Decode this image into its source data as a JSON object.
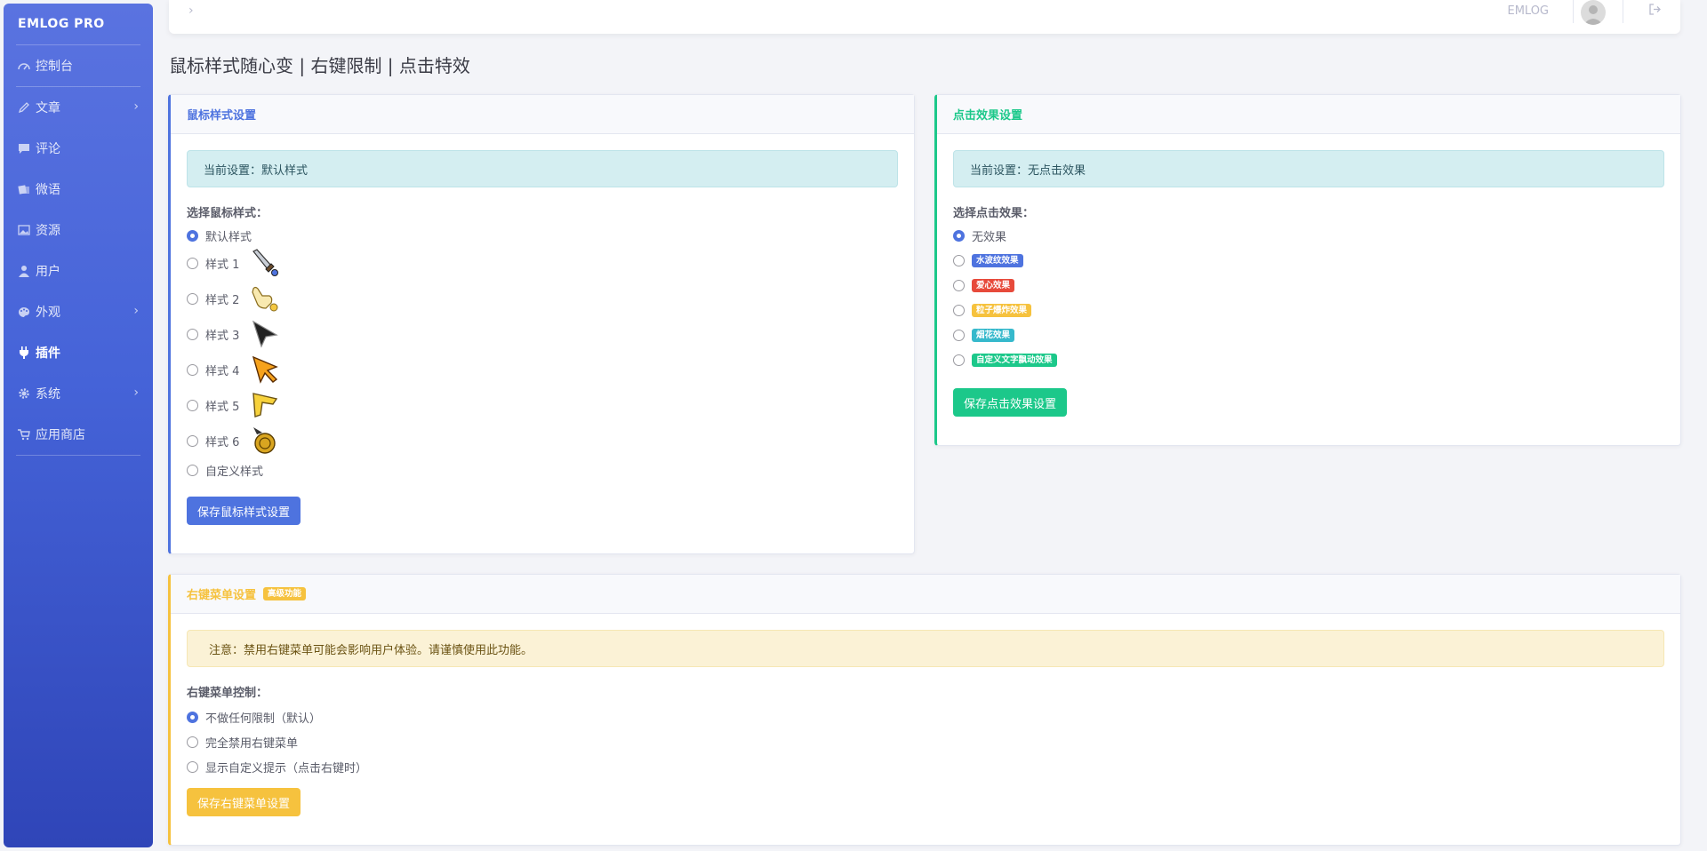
{
  "sidebar": {
    "brand": "EMLOG PRO",
    "items": [
      {
        "label": "控制台",
        "icon": "dashboard-icon"
      },
      {
        "label": "文章",
        "icon": "pencil-icon",
        "has_children": true
      },
      {
        "label": "评论",
        "icon": "comment-icon"
      },
      {
        "label": "微语",
        "icon": "note-icon"
      },
      {
        "label": "资源",
        "icon": "image-icon"
      },
      {
        "label": "用户",
        "icon": "user-icon"
      },
      {
        "label": "外观",
        "icon": "palette-icon",
        "has_children": true
      },
      {
        "label": "插件",
        "icon": "plug-icon",
        "active": true
      },
      {
        "label": "系统",
        "icon": "gear-icon",
        "has_children": true
      },
      {
        "label": "应用商店",
        "icon": "cart-icon"
      }
    ]
  },
  "topbar": {
    "toggle": "›",
    "site_name": "EMLOG",
    "logout_icon": "logout-icon"
  },
  "page_title": "鼠标样式随心变 | 右键限制 | 点击特效",
  "mouse_card": {
    "title": "鼠标样式设置",
    "accent": "#4e73df",
    "current": "当前设置：默认样式",
    "select_label": "选择鼠标样式：",
    "options": [
      {
        "label": "默认样式",
        "checked": true
      },
      {
        "label": "样式 1",
        "icon": "sword-cursor-icon"
      },
      {
        "label": "样式 2",
        "icon": "hand-cursor-icon"
      },
      {
        "label": "样式 3",
        "icon": "black-arrow-cursor-icon"
      },
      {
        "label": "样式 4",
        "icon": "orange-arrow-cursor-icon"
      },
      {
        "label": "样式 5",
        "icon": "yellow-arrow-cursor-icon"
      },
      {
        "label": "样式 6",
        "icon": "gold-coin-cursor-icon"
      },
      {
        "label": "自定义样式"
      }
    ],
    "save_label": "保存鼠标样式设置"
  },
  "click_card": {
    "title": "点击效果设置",
    "accent": "#1cc88a",
    "current": "当前设置：无点击效果",
    "select_label": "选择点击效果：",
    "options": [
      {
        "label": "无效果",
        "checked": true
      },
      {
        "label": "水波纹效果",
        "badge_color": "#4e73df"
      },
      {
        "label": "爱心效果",
        "badge_color": "#e74a3b"
      },
      {
        "label": "粒子爆炸效果",
        "badge_color": "#f6c23e"
      },
      {
        "label": "烟花效果",
        "badge_color": "#36b9cc"
      },
      {
        "label": "自定义文字飘动效果",
        "badge_color": "#1cc88a"
      }
    ],
    "save_label": "保存点击效果设置"
  },
  "rightclick_card": {
    "title": "右键菜单设置",
    "badge": "高级功能",
    "accent": "#f6c23e",
    "warning": "注意：禁用右键菜单可能会影响用户体验。请谨慎使用此功能。",
    "control_label": "右键菜单控制：",
    "options": [
      {
        "label": "不做任何限制（默认）",
        "checked": true
      },
      {
        "label": "完全禁用右键菜单"
      },
      {
        "label": "显示自定义提示（点击右键时）"
      }
    ],
    "save_label": "保存右键菜单设置"
  }
}
